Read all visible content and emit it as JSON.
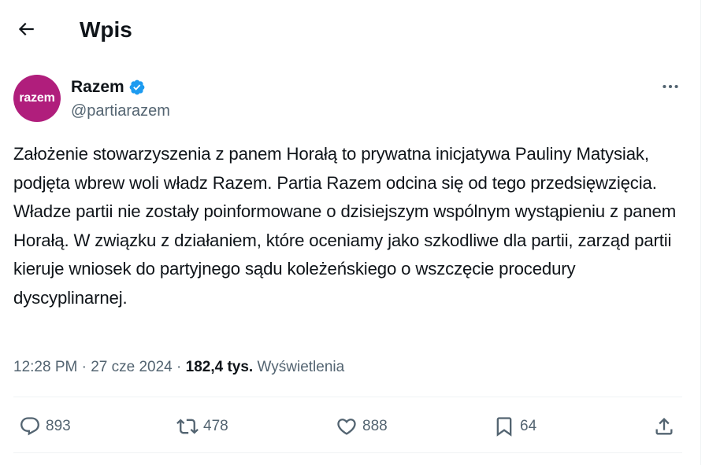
{
  "header": {
    "title": "Wpis",
    "back_icon": "arrow-left-icon"
  },
  "author": {
    "name": "Razem",
    "handle": "@partiarazem",
    "avatar_text": "razem",
    "avatar_color": "#b01e7c",
    "verified": true,
    "verified_color": "#1d9bf0"
  },
  "tweet": {
    "text": "Założenie stowarzyszenia z panem Horałą to prywatna inicjatywa Pauliny Matysiak, podjęta wbrew woli władz Razem. Partia Razem odcina się od tego przedsięwzięcia. Władze partii nie zostały poinformowane o dzisiejszym wspólnym wystąpieniu z panem Horałą. W związku z działaniem, które oceniamy jako szkodliwe dla partii, zarząd partii kieruje wniosek do partyjnego sądu koleżeńskiego o wszczęcie procedury dyscyplinarnej."
  },
  "meta": {
    "time": "12:28 PM",
    "date": "27 cze 2024",
    "separator": " · ",
    "views_count": "182,4 tys.",
    "views_label": "Wyświetlenia"
  },
  "actions": {
    "replies": "893",
    "reposts": "478",
    "likes": "888",
    "bookmarks": "64"
  },
  "colors": {
    "text": "#0f1419",
    "secondary": "#536471",
    "border": "#eff3f4"
  }
}
